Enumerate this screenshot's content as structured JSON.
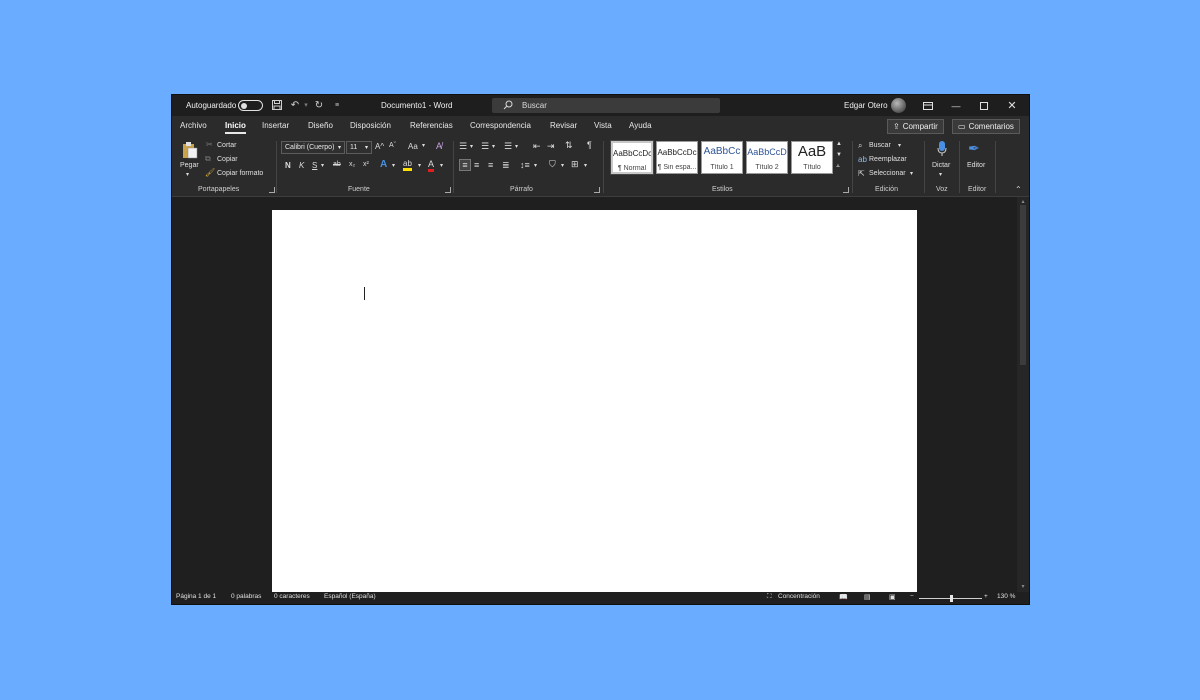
{
  "titlebar": {
    "autosave_label": "Autoguardado",
    "document_title": "Documento1  -  Word",
    "search_placeholder": "Buscar",
    "user_name": "Edgar Otero"
  },
  "tabs": [
    "Archivo",
    "Inicio",
    "Insertar",
    "Diseño",
    "Disposición",
    "Referencias",
    "Correspondencia",
    "Revisar",
    "Vista",
    "Ayuda"
  ],
  "active_tab": "Inicio",
  "top_buttons": {
    "share": "Compartir",
    "comments": "Comentarios"
  },
  "ribbon": {
    "clipboard": {
      "paste": "Pegar",
      "cut": "Cortar",
      "copy": "Copiar",
      "format_painter": "Copiar formato",
      "label": "Portapapeles"
    },
    "font": {
      "font_name": "Calibri (Cuerpo)",
      "font_size": "11",
      "grow": "A^",
      "shrink": "Aˇ",
      "change_case": "Aa",
      "bold": "N",
      "italic": "K",
      "underline": "S",
      "strike": "ab",
      "subscript": "x₂",
      "superscript": "x²",
      "text_effects": "A",
      "highlight": "ab",
      "font_color": "A",
      "label": "Fuente"
    },
    "paragraph": {
      "label": "Párrafo"
    },
    "styles": {
      "items": [
        {
          "preview": "AaBbCcDc",
          "name": "¶ Normal"
        },
        {
          "preview": "AaBbCcDc",
          "name": "¶ Sin espa..."
        },
        {
          "preview": "AaBbCc",
          "name": "Título 1"
        },
        {
          "preview": "AaBbCcD",
          "name": "Título 2"
        },
        {
          "preview": "AaB",
          "name": "Título"
        }
      ],
      "label": "Estilos"
    },
    "editing": {
      "find": "Buscar",
      "replace": "Reemplazar",
      "select": "Seleccionar",
      "label": "Edición"
    },
    "voice": {
      "dictate": "Dictar",
      "label": "Voz"
    },
    "editor": {
      "editor": "Editor",
      "label": "Editor"
    }
  },
  "statusbar": {
    "page": "Página 1 de 1",
    "words": "0 palabras",
    "chars": "0 caracteres",
    "language": "Español (España)",
    "focus": "Concentración",
    "zoom": "130 %"
  },
  "colors": {
    "accent_blue": "#6aacff",
    "highlight_yellow": "#ffe000",
    "font_red": "#e02020"
  }
}
